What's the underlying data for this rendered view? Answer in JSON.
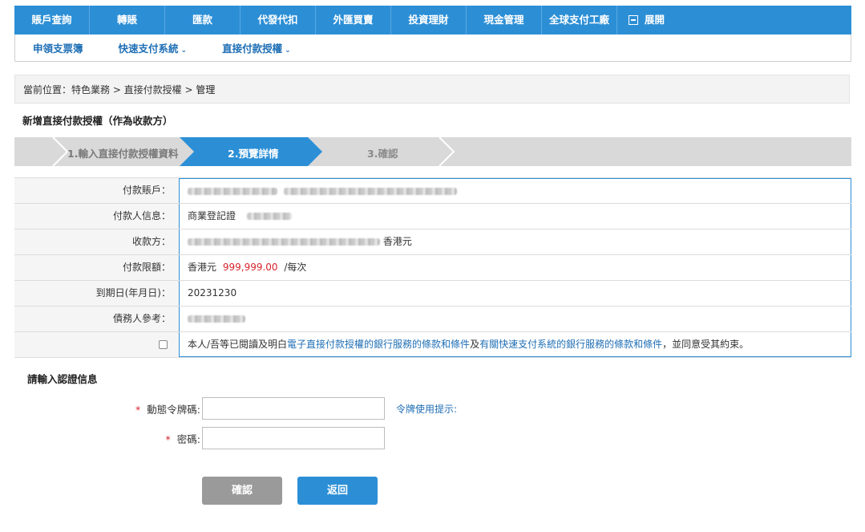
{
  "top_nav": [
    "賬戶查詢",
    "轉賬",
    "匯款",
    "代發代扣",
    "外匯買賣",
    "投資理財",
    "現金管理",
    "全球支付工廠"
  ],
  "expand_label": "展開",
  "sub_nav": [
    {
      "label": "申領支票簿",
      "dropdown": false
    },
    {
      "label": "快速支付系統",
      "dropdown": true
    },
    {
      "label": "直接付款授權",
      "dropdown": true
    }
  ],
  "breadcrumb": {
    "prefix": "當前位置：特色業務 > 直接付款授權 > ",
    "current": "管理"
  },
  "page_title": "新增直接付款授權（作為收款方）",
  "steps": [
    "1.輸入直接付款授權資料",
    "2.預覽詳情",
    "3.確認"
  ],
  "detail": {
    "payer_account_label": "付款賬戶：",
    "payer_info_label": "付款人信息：",
    "payer_info_value": "商業登記證",
    "payee_label": "收款方：",
    "payee_currency": "香港元",
    "limit_label": "付款限額：",
    "limit_currency": "香港元",
    "limit_amount": "999,999.00",
    "limit_suffix": "/每次",
    "expiry_label": "到期日(年月日)：",
    "expiry_value": "20231230",
    "debtor_ref_label": "債務人參考："
  },
  "terms": {
    "prefix": "本人/吾等已閱讀及明白",
    "link1": "電子直接付款授權的銀行服務的條款和條件",
    "middle": "及",
    "link2": "有關快速支付系統的銀行服務的條款和條件",
    "suffix": "，並同意受其約束。"
  },
  "auth": {
    "title": "請輸入認證信息",
    "token_label": "動態令牌碼:",
    "token_hint": "令牌使用提示:",
    "password_label": "密碼:",
    "required_mark": "*"
  },
  "buttons": {
    "confirm": "確認",
    "back": "返回"
  },
  "colors": {
    "primary": "#2c8fd6",
    "disabled_button": "#9a9a9a",
    "amount_red": "#d9232d",
    "link": "#1f6fb5"
  }
}
